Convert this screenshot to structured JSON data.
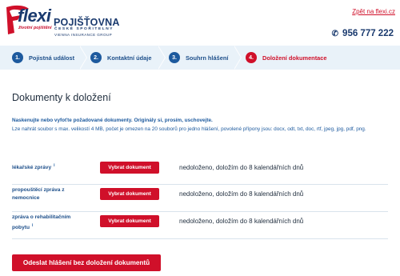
{
  "header": {
    "brand": "flexi",
    "brand_sub": "životní pojištění",
    "insurer": "POJIŠŤOVNA",
    "insurer_sub": "ČESKÉ SPOŘITELNY",
    "insurer_group": "VIENNA INSURANCE GROUP",
    "back_link": "Zpět na flexi.cz",
    "phone": "956 777 222"
  },
  "steps": [
    {
      "num": "1.",
      "label": "Pojistná událost"
    },
    {
      "num": "2.",
      "label": "Kontaktní údaje"
    },
    {
      "num": "3.",
      "label": "Souhrn hlášení"
    },
    {
      "num": "4.",
      "label": "Doložení dokumentace"
    }
  ],
  "main": {
    "title": "Dokumenty k doložení",
    "intro_bold": "Naskenujte nebo vyfoťte požadované dokumenty. Originály si, prosím, uschovejte.",
    "intro_text": "Lze nahrát soubor s max. velikostí 4 MB, počet je omezen na 20 souborů pro jedno hlášení, povolené přípony jsou: docx, odt, txt, doc, rtf, jpeg, jpg, pdf, png.",
    "documents": [
      {
        "label": "lékařské zprávy",
        "button": "Vybrat dokument",
        "status": "nedoloženo, doložím do 8 kalendářních dnů"
      },
      {
        "label": "propouštěcí zpráva z nemocnice",
        "button": "Vybrat dokument",
        "status": "nedoloženo, doložím do 8 kalendářních dnů"
      },
      {
        "label": "zpráva o rehabilitačním pobytu",
        "button": "Vybrat dokument",
        "status": "nedoloženo, doložím do 8 kalendářních dnů"
      }
    ],
    "submit": "Odeslat hlášení bez doložení dokumentů"
  },
  "colors": {
    "accent": "#d0102a",
    "brand": "#1a3a6e",
    "step_bg": "#e9f2f9"
  },
  "icons": {
    "logo": "flexi-logo-icon",
    "phone": "phone-icon",
    "info": "info-icon"
  }
}
